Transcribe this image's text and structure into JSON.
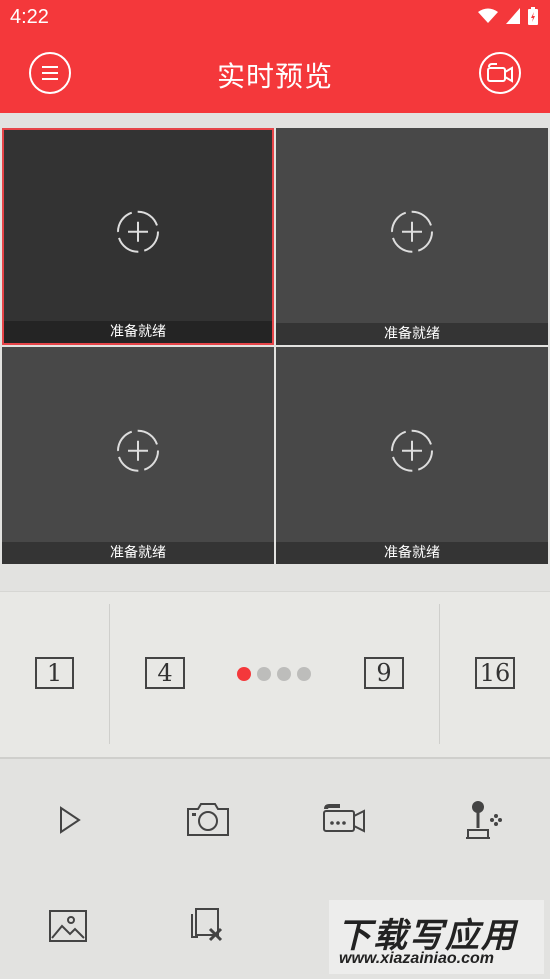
{
  "status_bar": {
    "time": "4:22"
  },
  "header": {
    "title": "实时预览"
  },
  "grid": {
    "tiles": [
      {
        "status": "准备就绪",
        "selected": true
      },
      {
        "status": "准备就绪",
        "selected": false
      },
      {
        "status": "准备就绪",
        "selected": false
      },
      {
        "status": "准备就绪",
        "selected": false
      }
    ]
  },
  "layout_bar": {
    "options": [
      "1",
      "4",
      "9",
      "16"
    ],
    "page_dots": 4,
    "active_dot": 0
  },
  "toolbar": {
    "icons": [
      "play-icon",
      "snapshot-icon",
      "record-icon",
      "ptz-joystick-icon",
      "gallery-icon",
      "close-all-icon"
    ]
  },
  "watermark": {
    "title": "下载写应用",
    "url": "www.xiazainiao.com"
  },
  "colors": {
    "accent": "#f4383b",
    "tile": "#484848",
    "tile_selected": "#333333"
  }
}
